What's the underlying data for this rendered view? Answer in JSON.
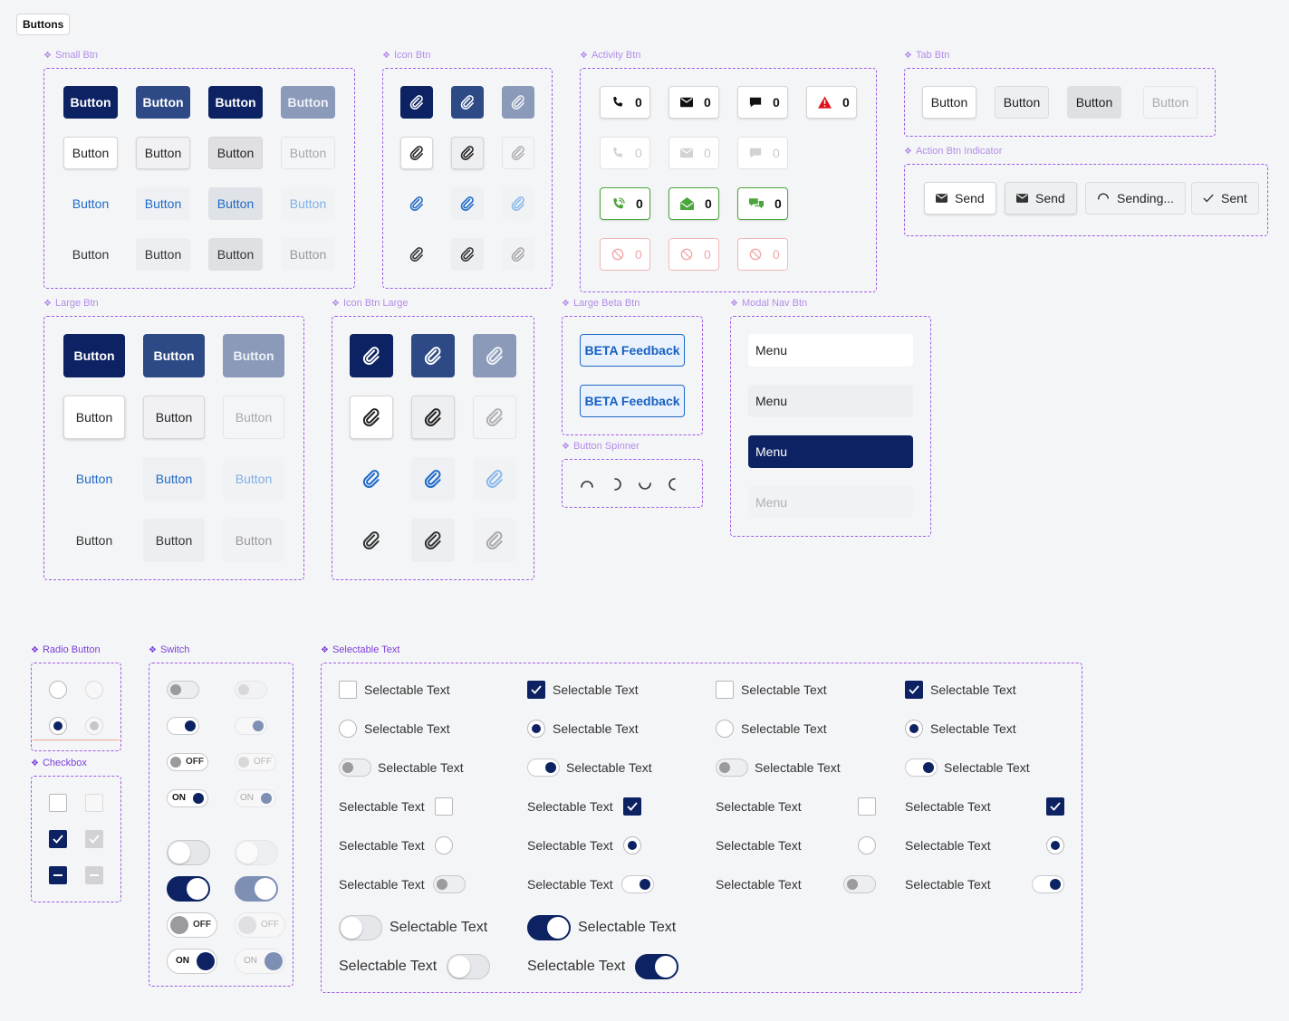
{
  "page_tag": "Buttons",
  "sections": {
    "small_btn": "Small Btn",
    "icon_btn": "Icon Btn",
    "activity_btn": "Activity Btn",
    "tab_btn": "Tab Btn",
    "action_indicator": "Action Btn Indicator",
    "large_btn": "Large Btn",
    "icon_btn_large": "Icon Btn Large",
    "large_beta_btn": "Large Beta Btn",
    "button_spinner": "Button Spinner",
    "modal_nav_btn": "Modal Nav Btn",
    "radio_button": "Radio Button",
    "checkbox": "Checkbox",
    "switch": "Switch",
    "selectable_text": "Selectable Text"
  },
  "button_label": "Button",
  "activity_count": "0",
  "action_indicator": {
    "send": "Send",
    "sending": "Sending...",
    "sent": "Sent"
  },
  "beta_label": "BETA Feedback",
  "menu_label": "Menu",
  "switch_text": {
    "off": "OFF",
    "on": "ON"
  },
  "selectable_label": "Selectable Text",
  "colors": {
    "primary": "#0c2262",
    "primary_mid": "#2e4a86",
    "primary_disabled": "#8b9ab9",
    "link": "#1f6ac7",
    "success": "#4aa53a",
    "danger": "#e0121a",
    "section_label": "#b48de8",
    "dashed_border": "#a05ce6"
  },
  "icons": [
    "paperclip-icon",
    "phone-icon",
    "envelope-icon",
    "chat-icon",
    "warning-icon",
    "ban-icon",
    "spinner-icon",
    "check-icon"
  ]
}
